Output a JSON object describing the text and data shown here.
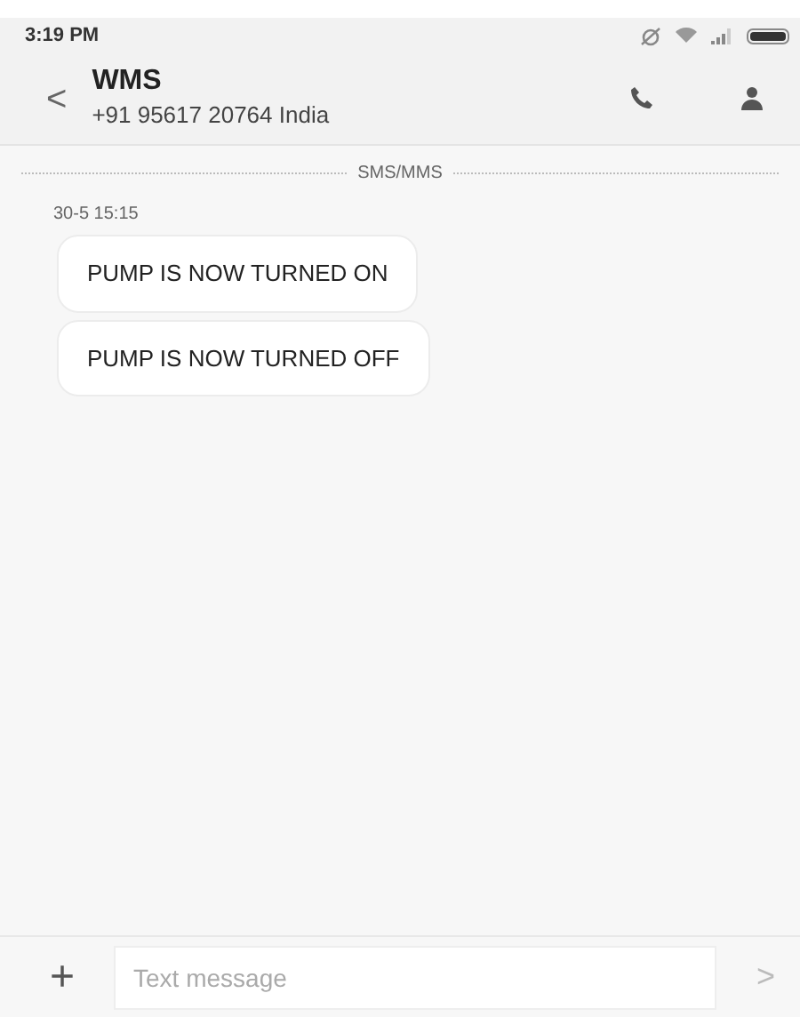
{
  "status_bar": {
    "time": "3:19 PM"
  },
  "header": {
    "back": "<",
    "title": "WMS",
    "subtitle": "+91 95617 20764 India"
  },
  "thread": {
    "channel": "SMS/MMS",
    "timestamp": "30-5 15:15",
    "messages": [
      {
        "text": "PUMP IS NOW TURNED ON"
      },
      {
        "text": "PUMP IS NOW TURNED OFF"
      }
    ]
  },
  "composer": {
    "add": "+",
    "placeholder": "Text message",
    "send": ">"
  }
}
